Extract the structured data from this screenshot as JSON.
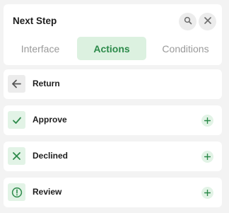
{
  "header": {
    "title": "Next Step",
    "search_icon": "search-icon",
    "close_icon": "close-icon"
  },
  "tabs": [
    {
      "label": "Interface",
      "active": false
    },
    {
      "label": "Actions",
      "active": true
    },
    {
      "label": "Conditions",
      "active": false
    }
  ],
  "actions": [
    {
      "label": "Return",
      "icon": "arrow-left-icon",
      "addable": false
    },
    {
      "label": "Approve",
      "icon": "check-icon",
      "addable": true
    },
    {
      "label": "Declined",
      "icon": "x-icon",
      "addable": true
    },
    {
      "label": "Review",
      "icon": "exclamation-circle-icon",
      "addable": true
    }
  ],
  "colors": {
    "accent": "#2c8a4a",
    "accent_bg": "#dcf1e0",
    "background": "#f3f3f3"
  }
}
